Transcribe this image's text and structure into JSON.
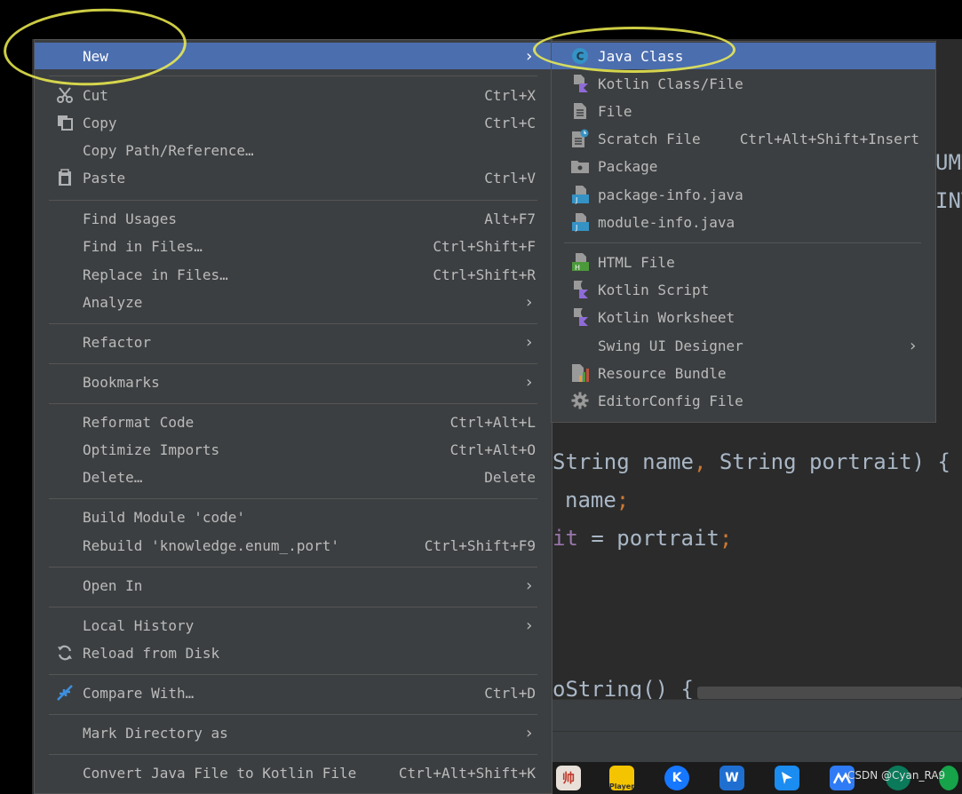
{
  "editor": {
    "code_right_top_1": "UMM",
    "code_right_top_2": "INT",
    "line1_a": "String name",
    "line1_comma": ",",
    "line1_b": " String portrait) {",
    "line2_a": "name",
    "line2_semi": ";",
    "line3_field": "it",
    "line3_rest": " = portrait",
    "line3_semi": ";",
    "line4": "oString() {"
  },
  "main_menu": {
    "new": {
      "label": "New"
    },
    "cut": {
      "label": "Cut",
      "shortcut": "Ctrl+X"
    },
    "copy": {
      "label": "Copy",
      "shortcut": "Ctrl+C"
    },
    "copy_path": {
      "label": "Copy Path/Reference…"
    },
    "paste": {
      "label": "Paste",
      "shortcut": "Ctrl+V"
    },
    "find_usages": {
      "label": "Find Usages",
      "shortcut": "Alt+F7"
    },
    "find_in_files": {
      "label": "Find in Files…",
      "shortcut": "Ctrl+Shift+F"
    },
    "replace_in_files": {
      "label": "Replace in Files…",
      "shortcut": "Ctrl+Shift+R"
    },
    "analyze": {
      "label": "Analyze"
    },
    "refactor": {
      "label": "Refactor"
    },
    "bookmarks": {
      "label": "Bookmarks"
    },
    "reformat_code": {
      "label": "Reformat Code",
      "shortcut": "Ctrl+Alt+L"
    },
    "optimize_imports": {
      "label": "Optimize Imports",
      "shortcut": "Ctrl+Alt+O"
    },
    "delete": {
      "label": "Delete…",
      "shortcut": "Delete"
    },
    "build_module": {
      "label": "Build Module 'code'"
    },
    "rebuild": {
      "label": "Rebuild 'knowledge.enum_.port'",
      "shortcut": "Ctrl+Shift+F9"
    },
    "open_in": {
      "label": "Open In"
    },
    "local_history": {
      "label": "Local History"
    },
    "reload_from_disk": {
      "label": "Reload from Disk"
    },
    "compare_with": {
      "label": "Compare With…",
      "shortcut": "Ctrl+D"
    },
    "mark_directory": {
      "label": "Mark Directory as"
    },
    "convert_java": {
      "label": "Convert Java File to Kotlin File",
      "shortcut": "Ctrl+Alt+Shift+K"
    }
  },
  "sub_menu": {
    "java_class": {
      "label": "Java Class"
    },
    "kotlin_class": {
      "label": "Kotlin Class/File"
    },
    "file": {
      "label": "File"
    },
    "scratch_file": {
      "label": "Scratch File",
      "shortcut": "Ctrl+Alt+Shift+Insert"
    },
    "package": {
      "label": "Package"
    },
    "package_info": {
      "label": "package-info.java"
    },
    "module_info": {
      "label": "module-info.java"
    },
    "html_file": {
      "label": "HTML File"
    },
    "kotlin_script": {
      "label": "Kotlin Script"
    },
    "kotlin_worksheet": {
      "label": "Kotlin Worksheet"
    },
    "swing_ui": {
      "label": "Swing UI Designer"
    },
    "resource_bundle": {
      "label": "Resource Bundle"
    },
    "editorconfig": {
      "label": "EditorConfig File"
    }
  },
  "taskbar": {
    "watermark": "CSDN @Cyan_RA9",
    "icon_shuai": "帅",
    "icon_player": "Player",
    "icon_k": "K",
    "icon_w": "W"
  },
  "colors": {
    "menu_bg": "#3c3f41",
    "selection": "#4b6eaf",
    "editor_bg": "#2b2b2b",
    "highlight": "#f0f050"
  },
  "arrow_glyph": "›"
}
